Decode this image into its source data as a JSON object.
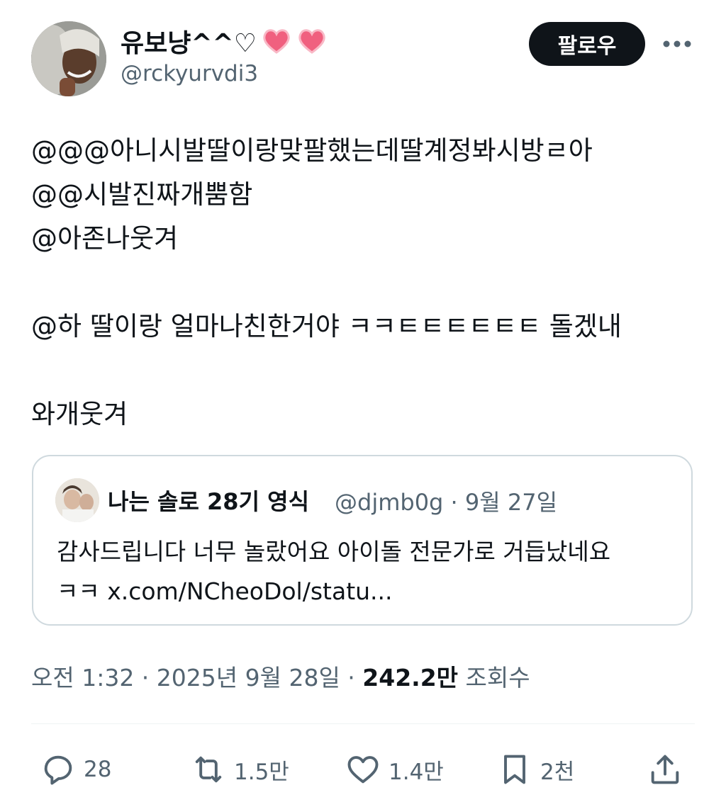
{
  "author": {
    "display_name": "유보냥^^♡",
    "heart_icons": [
      "heart-icon",
      "heart-icon"
    ],
    "handle": "@rckyurvdi3"
  },
  "follow_label": "팔로우",
  "tweet_lines": [
    "@@@아니시발딸이랑맞팔했는데딸계정봐시방ㄹ아",
    "@@시발진짜개뿜함",
    "@아존나웃겨",
    "",
    "@하 딸이랑 얼마나친한거야 ㅋㅋㅌㅌㅌㅌㅌㅌ 돌겠내",
    "",
    "와개웃겨"
  ],
  "quote": {
    "name": "나는 솔로 28기 영식",
    "meta": "@djmb0g · 9월 27일",
    "lines": [
      "감사드립니다 너무 놀랐어요 아이돌 전문가로 거듭났네요",
      "ㅋㅋ x.com/NCheoDol/statu..."
    ]
  },
  "meta": {
    "time": "오전 1:32 · 2025년 9월 28일 · ",
    "views": "242.2만",
    "views_label": " 조회수"
  },
  "actions": {
    "reply_count": "28",
    "retweet_count": "1.5만",
    "like_count": "1.4만",
    "bookmark_count": "2천"
  },
  "colors": {
    "text": "#0f1419",
    "secondary": "#536471",
    "border": "#cfd9de",
    "heart": "#f0607f"
  }
}
